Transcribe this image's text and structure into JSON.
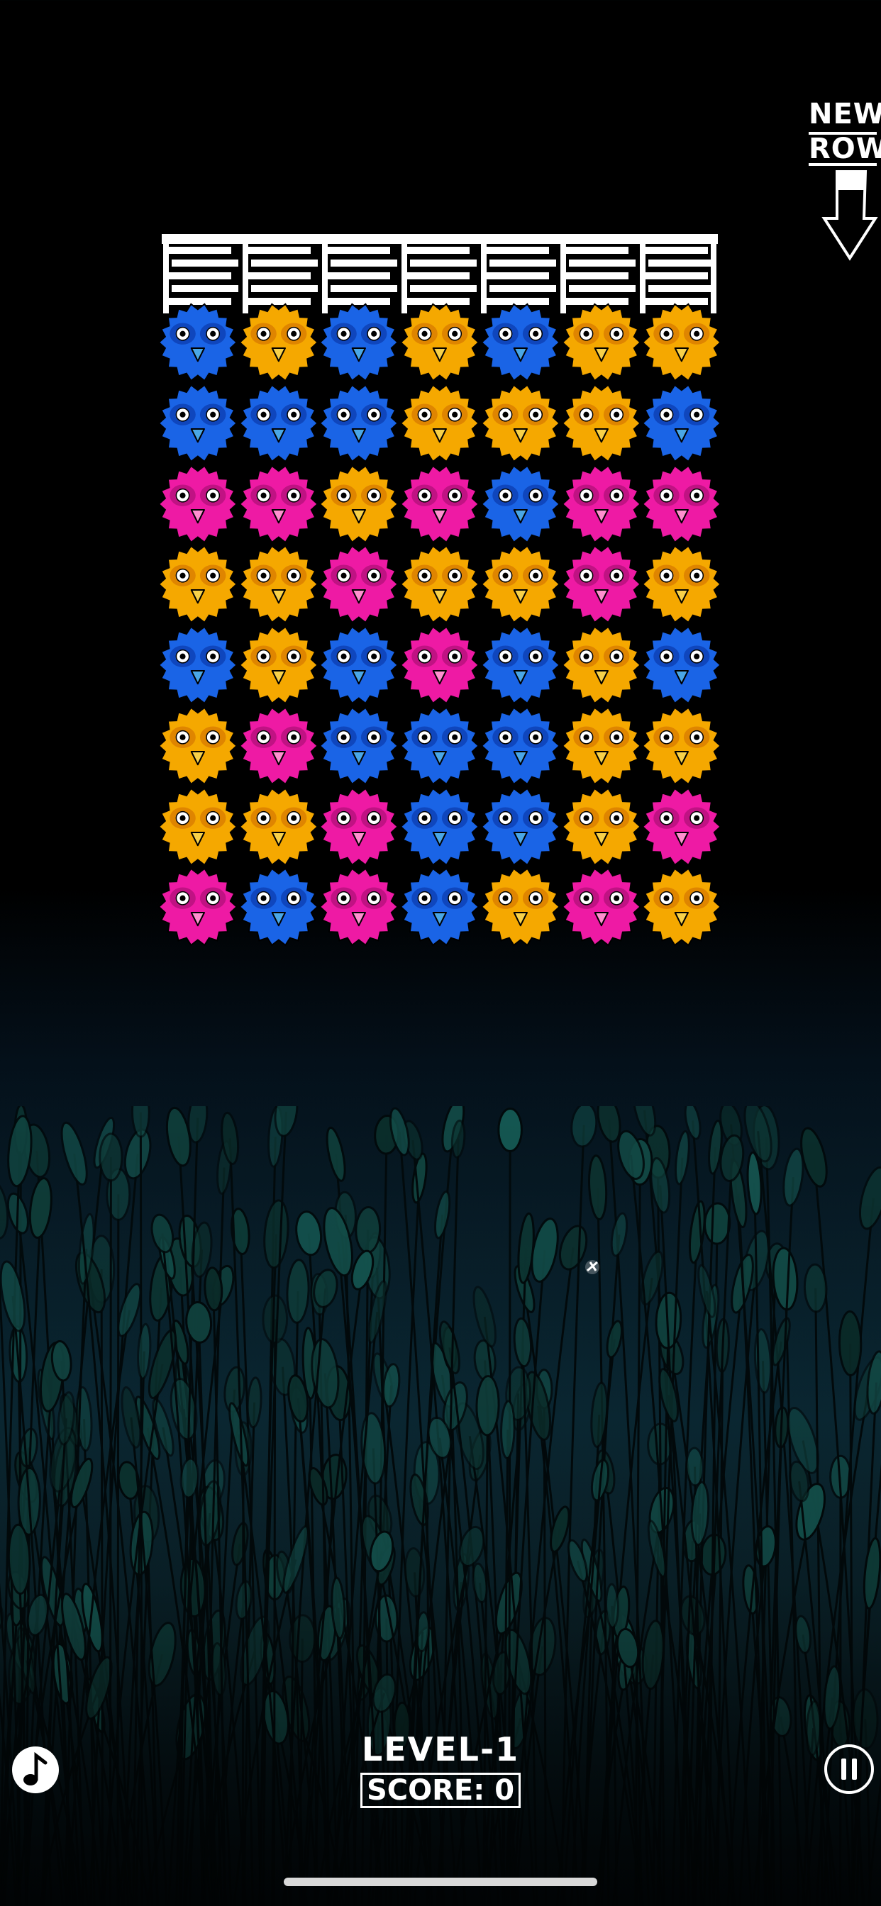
{
  "game": {
    "new_row_line1": "NEW",
    "new_row_line2": "ROW",
    "level_text": "LEVEL-1",
    "score_label": "SCORE:",
    "score_value": "0"
  },
  "colors": {
    "blue": "#1a64e6",
    "yellow": "#f5a800",
    "pink": "#ee1aa4"
  },
  "icons": {
    "music": "music-note-icon",
    "pause": "pause-icon",
    "new_row": "arrow-down-icon"
  },
  "board": {
    "columns": 7,
    "rows": [
      [
        "blue",
        "yellow",
        "blue",
        "yellow",
        "blue",
        "yellow",
        "yellow"
      ],
      [
        "blue",
        "blue",
        "blue",
        "yellow",
        "yellow",
        "yellow",
        "blue"
      ],
      [
        "pink",
        "pink",
        "yellow",
        "pink",
        "blue",
        "pink",
        "pink"
      ],
      [
        "yellow",
        "yellow",
        "pink",
        "yellow",
        "yellow",
        "pink",
        "yellow"
      ],
      [
        "blue",
        "yellow",
        "blue",
        "pink",
        "blue",
        "yellow",
        "blue"
      ],
      [
        "yellow",
        "pink",
        "blue",
        "blue",
        "blue",
        "yellow",
        "yellow"
      ],
      [
        "yellow",
        "yellow",
        "pink",
        "blue",
        "blue",
        "yellow",
        "pink"
      ],
      [
        "pink",
        "blue",
        "pink",
        "blue",
        "yellow",
        "pink",
        "yellow"
      ]
    ]
  }
}
